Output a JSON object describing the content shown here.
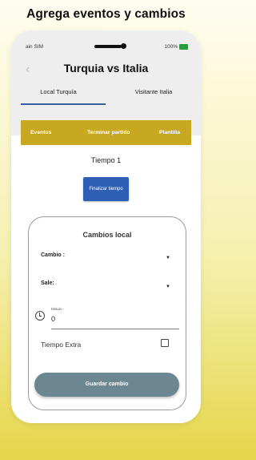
{
  "headline": "Agrega eventos y cambios",
  "status_bar": {
    "carrier": "ain SIM",
    "battery": "100%",
    "colors": {
      "battery": "#2c9a3e"
    }
  },
  "app_bar": {
    "title": "Turquia vs Italia",
    "back_icon": "chevron-left-icon",
    "tabs": [
      {
        "label": "Local Turquía",
        "selected": true
      },
      {
        "label": "Visitante Italia",
        "selected": false
      }
    ]
  },
  "menu": {
    "items": [
      "Eventos",
      "Terminar partido",
      "Plantilla"
    ],
    "color": "#c8a820"
  },
  "period": {
    "label": "Tiempo 1"
  },
  "finalizar_button": {
    "label": "Finalizar tiempo",
    "color": "#2e5fb4"
  },
  "change_form": {
    "title": "Cambios local",
    "cambio": {
      "label": "Cambio :",
      "icon": "caret-down-icon"
    },
    "sale": {
      "label": "Sale:",
      "icon": "caret-down-icon"
    },
    "minuto": {
      "label": "Minuto -",
      "value": "0",
      "icon": "clock-icon"
    },
    "tiempo_extra": {
      "label": "Tiempo Extra",
      "checked": false
    },
    "save_button": {
      "label": "Guardar cambio",
      "color": "#6c8792"
    }
  }
}
